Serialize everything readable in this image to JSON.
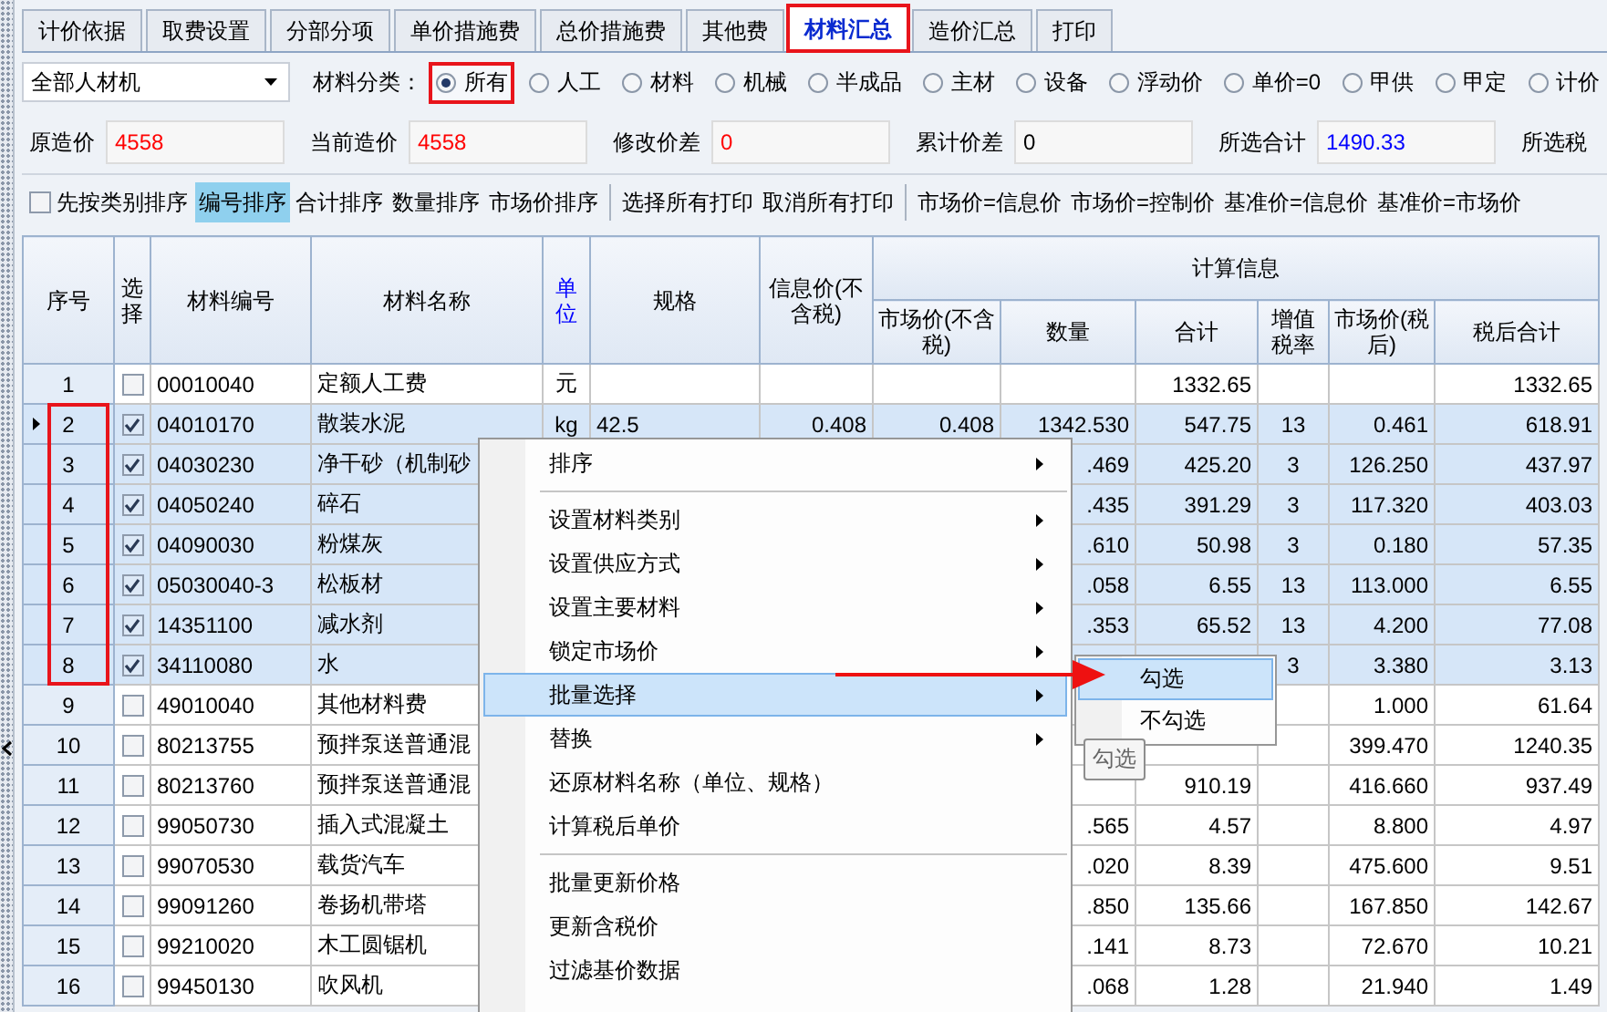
{
  "tabs": [
    {
      "label": "计价依据",
      "selected": false,
      "annotated": false
    },
    {
      "label": "取费设置",
      "selected": false,
      "annotated": false
    },
    {
      "label": "分部分项",
      "selected": false,
      "annotated": false
    },
    {
      "label": "单价措施费",
      "selected": false,
      "annotated": false
    },
    {
      "label": "总价措施费",
      "selected": false,
      "annotated": false
    },
    {
      "label": "其他费",
      "selected": false,
      "annotated": false
    },
    {
      "label": "材料汇总",
      "selected": true,
      "annotated": true
    },
    {
      "label": "造价汇总",
      "selected": false,
      "annotated": false
    },
    {
      "label": "打印",
      "selected": false,
      "annotated": false
    }
  ],
  "filter_bar": {
    "dropdown": {
      "value": "全部人材机"
    },
    "category_label": "材料分类：",
    "categories": [
      {
        "label": "所有",
        "selected": true,
        "annotated": true
      },
      {
        "label": "人工",
        "selected": false,
        "annotated": false
      },
      {
        "label": "材料",
        "selected": false,
        "annotated": false
      },
      {
        "label": "机械",
        "selected": false,
        "annotated": false
      },
      {
        "label": "半成品",
        "selected": false,
        "annotated": false
      },
      {
        "label": "主材",
        "selected": false,
        "annotated": false
      },
      {
        "label": "设备",
        "selected": false,
        "annotated": false
      },
      {
        "label": "浮动价",
        "selected": false,
        "annotated": false
      },
      {
        "label": "单价=0",
        "selected": false,
        "annotated": false
      },
      {
        "label": "甲供",
        "selected": false,
        "annotated": false
      },
      {
        "label": "甲定",
        "selected": false,
        "annotated": false
      },
      {
        "label": "计价",
        "selected": false,
        "annotated": false
      }
    ]
  },
  "price_fields": [
    {
      "label": "原造价",
      "value": "4558",
      "color": "#ff0000"
    },
    {
      "label": "当前造价",
      "value": "4558",
      "color": "#ff0000"
    },
    {
      "label": "修改价差",
      "value": "0",
      "color": "#ff0000"
    },
    {
      "label": "累计价差",
      "value": "0",
      "color": "#000000"
    },
    {
      "label": "所选合计",
      "value": "1490.33",
      "color": "#0000ff"
    },
    {
      "label": "所选税"
    }
  ],
  "sort_bar": {
    "category_first": {
      "label": "先按类别排序",
      "checked": false
    },
    "sort_buttons": [
      {
        "label": "编号排序",
        "selected": true
      },
      {
        "label": "合计排序",
        "selected": false
      },
      {
        "label": "数量排序",
        "selected": false
      },
      {
        "label": "市场价排序",
        "selected": false
      }
    ],
    "print_buttons": [
      "选择所有打印",
      "取消所有打印"
    ],
    "price_buttons": [
      "市场价=信息价",
      "市场价=控制价",
      "基准价=信息价",
      "基准价=市场价"
    ]
  },
  "table": {
    "group_label": "计算信息",
    "columns": [
      {
        "label": "序号",
        "grouped": false,
        "color": "#000000"
      },
      {
        "label": "选择",
        "grouped": false,
        "color": "#000000"
      },
      {
        "label": "材料编号",
        "grouped": false,
        "color": "#000000"
      },
      {
        "label": "材料名称",
        "grouped": false,
        "color": "#000000"
      },
      {
        "label": "单位",
        "grouped": false,
        "color": "#0000ff"
      },
      {
        "label": "规格",
        "grouped": false,
        "color": "#000000"
      },
      {
        "label": "信息价(不含税)",
        "grouped": false,
        "color": "#000000"
      },
      {
        "label": "市场价(不含税)",
        "grouped": true,
        "color": "#000000"
      },
      {
        "label": "数量",
        "grouped": true,
        "color": "#000000"
      },
      {
        "label": "合计",
        "grouped": true,
        "color": "#000000"
      },
      {
        "label": "增值税率",
        "grouped": true,
        "color": "#000000"
      },
      {
        "label": "市场价(税后)",
        "grouped": true,
        "color": "#000000"
      },
      {
        "label": "税后合计",
        "grouped": true,
        "color": "#000000"
      }
    ],
    "rows": [
      {
        "seq": "1",
        "checked": false,
        "selected": false,
        "current": false,
        "annotated": false,
        "code": "00010040",
        "name": "定额人工费",
        "unit": "元",
        "total": "1332.65",
        "total_after_tax": "1332.65"
      },
      {
        "seq": "2",
        "checked": true,
        "selected": true,
        "current": true,
        "annotated": true,
        "code": "04010170",
        "name": "散装水泥",
        "unit": "kg",
        "spec": "42.5",
        "info_price": "0.408",
        "market_price": "0.408",
        "quantity": "1342.530",
        "total": "547.75",
        "vat_rate": "13",
        "market_after_tax": "0.461",
        "total_after_tax": "618.91"
      },
      {
        "seq": "3",
        "checked": true,
        "selected": true,
        "current": false,
        "annotated": true,
        "code": "04030230",
        "name": "净干砂（机制砂",
        "quantity": ".469",
        "total": "425.20",
        "vat_rate": "3",
        "market_after_tax": "126.250",
        "total_after_tax": "437.97"
      },
      {
        "seq": "4",
        "checked": true,
        "selected": true,
        "current": false,
        "annotated": true,
        "code": "04050240",
        "name": "碎石",
        "quantity": ".435",
        "total": "391.29",
        "vat_rate": "3",
        "market_after_tax": "117.320",
        "total_after_tax": "403.03"
      },
      {
        "seq": "5",
        "checked": true,
        "selected": true,
        "current": false,
        "annotated": true,
        "code": "04090030",
        "name": "粉煤灰",
        "quantity": ".610",
        "total": "50.98",
        "vat_rate": "3",
        "market_after_tax": "0.180",
        "total_after_tax": "57.35"
      },
      {
        "seq": "6",
        "checked": true,
        "selected": true,
        "current": false,
        "annotated": true,
        "code": "05030040-3",
        "name": "松板材",
        "quantity": ".058",
        "total": "6.55",
        "vat_rate": "13",
        "market_after_tax": "113.000",
        "total_after_tax": "6.55"
      },
      {
        "seq": "7",
        "checked": true,
        "selected": true,
        "current": false,
        "annotated": true,
        "code": "14351100",
        "name": "减水剂",
        "quantity": ".353",
        "total": "65.52",
        "vat_rate": "13",
        "market_after_tax": "4.200",
        "total_after_tax": "77.08"
      },
      {
        "seq": "8",
        "checked": true,
        "selected": true,
        "current": false,
        "annotated": true,
        "code": "34110080",
        "name": "水",
        "vat_rate": "3",
        "market_after_tax": "3.380",
        "total_after_tax": "3.13"
      },
      {
        "seq": "9",
        "checked": false,
        "selected": false,
        "current": false,
        "annotated": false,
        "code": "49010040",
        "name": "其他材料费",
        "market_after_tax": "1.000",
        "total_after_tax": "61.64"
      },
      {
        "seq": "10",
        "checked": false,
        "selected": false,
        "current": false,
        "annotated": false,
        "code": "80213755",
        "name": "预拌泵送普通混",
        "market_after_tax": "399.470",
        "total_after_tax": "1240.35"
      },
      {
        "seq": "11",
        "checked": false,
        "selected": false,
        "current": false,
        "annotated": false,
        "code": "80213760",
        "name": "预拌泵送普通混",
        "total": "910.19",
        "market_after_tax": "416.660",
        "total_after_tax": "937.49"
      },
      {
        "seq": "12",
        "checked": false,
        "selected": false,
        "current": false,
        "annotated": false,
        "code": "99050730",
        "name": "插入式混凝土",
        "quantity": ".565",
        "total": "4.57",
        "market_after_tax": "8.800",
        "total_after_tax": "4.97"
      },
      {
        "seq": "13",
        "checked": false,
        "selected": false,
        "current": false,
        "annotated": false,
        "code": "99070530",
        "name": "载货汽车",
        "quantity": ".020",
        "total": "8.39",
        "market_after_tax": "475.600",
        "total_after_tax": "9.51"
      },
      {
        "seq": "14",
        "checked": false,
        "selected": false,
        "current": false,
        "annotated": false,
        "code": "99091260",
        "name": "卷扬机带塔",
        "quantity": ".850",
        "total": "135.66",
        "market_after_tax": "167.850",
        "total_after_tax": "142.67"
      },
      {
        "seq": "15",
        "checked": false,
        "selected": false,
        "current": false,
        "annotated": false,
        "code": "99210020",
        "name": "木工圆锯机",
        "quantity": ".141",
        "total": "8.73",
        "market_after_tax": "72.670",
        "total_after_tax": "10.21"
      },
      {
        "seq": "16",
        "checked": false,
        "selected": false,
        "current": false,
        "annotated": false,
        "code": "99450130",
        "name": "吹风机",
        "quantity": ".068",
        "total": "1.28",
        "market_after_tax": "21.940",
        "total_after_tax": "1.49"
      }
    ]
  },
  "context_menu": {
    "annotation_arrow": true,
    "items": [
      {
        "kind": "item",
        "label": "排序",
        "submenu": true,
        "selected": false
      },
      {
        "kind": "separator"
      },
      {
        "kind": "item",
        "label": "设置材料类别",
        "submenu": true,
        "selected": false
      },
      {
        "kind": "item",
        "label": "设置供应方式",
        "submenu": true,
        "selected": false
      },
      {
        "kind": "item",
        "label": "设置主要材料",
        "submenu": true,
        "selected": false
      },
      {
        "kind": "item",
        "label": "锁定市场价",
        "submenu": true,
        "selected": false
      },
      {
        "kind": "item",
        "label": "批量选择",
        "submenu": true,
        "selected": true
      },
      {
        "kind": "item",
        "label": "替换",
        "submenu": true,
        "selected": false
      },
      {
        "kind": "item",
        "label": "还原材料名称（单位、规格）",
        "submenu": false,
        "selected": false
      },
      {
        "kind": "item",
        "label": "计算税后单价",
        "submenu": false,
        "selected": false
      },
      {
        "kind": "separator"
      },
      {
        "kind": "item",
        "label": "批量更新价格",
        "submenu": false,
        "selected": false
      },
      {
        "kind": "item",
        "label": "更新含税价",
        "submenu": false,
        "selected": false
      },
      {
        "kind": "item",
        "label": "过滤基价数据",
        "submenu": false,
        "selected": false
      }
    ]
  },
  "submenu": {
    "items": [
      {
        "label": "勾选",
        "selected": true
      },
      {
        "label": "不勾选",
        "selected": false
      }
    ]
  },
  "tooltip": {
    "text": "勾选"
  }
}
